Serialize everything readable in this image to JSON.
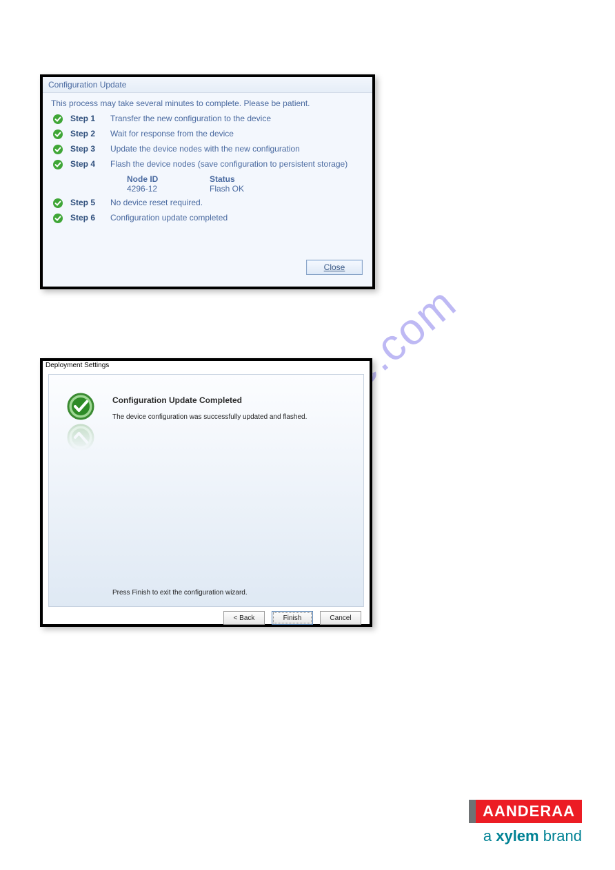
{
  "watermark": "manualshive.com",
  "dialog1": {
    "title": "Configuration Update",
    "intro": "This process may take several minutes to complete. Please be patient.",
    "steps": [
      {
        "label": "Step 1",
        "desc": "Transfer the new configuration to the device"
      },
      {
        "label": "Step 2",
        "desc": "Wait for response from the device"
      },
      {
        "label": "Step 3",
        "desc": "Update the device nodes with the new configuration"
      },
      {
        "label": "Step 4",
        "desc": "Flash the device nodes (save configuration to persistent storage)"
      },
      {
        "label": "Step 5",
        "desc": "No device reset required."
      },
      {
        "label": "Step 6",
        "desc": "Configuration update completed"
      }
    ],
    "table": {
      "h1": "Node ID",
      "h2": "Status",
      "r1c1": "4296-12",
      "r1c2": "Flash OK"
    },
    "close_prefix": "C",
    "close_rest": "lose"
  },
  "dialog2": {
    "title": "Deployment Settings",
    "heading": "Configuration Update Completed",
    "subtext": "The device configuration was successfully updated and flashed.",
    "footer": "Press Finish to exit the configuration wizard.",
    "buttons": {
      "back": "< Back",
      "finish": "Finish",
      "cancel": "Cancel"
    }
  },
  "brand": {
    "name": "AANDERAA",
    "sub_a": "a ",
    "sub_x": "xylem",
    "sub_b": " brand"
  }
}
